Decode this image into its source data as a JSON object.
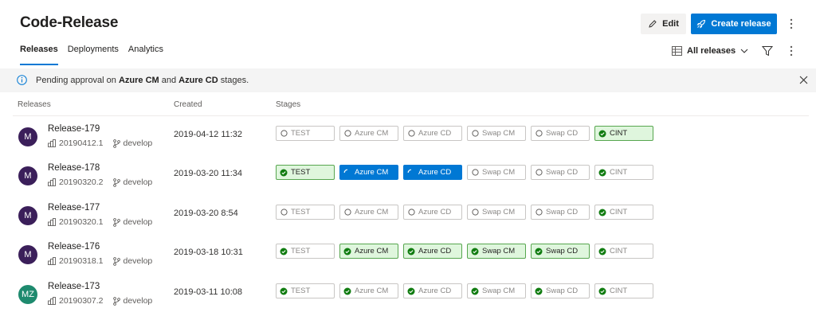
{
  "header": {
    "title": "Code-Release",
    "edit_label": "Edit",
    "create_label": "Create release"
  },
  "tabs": [
    {
      "label": "Releases",
      "active": true
    },
    {
      "label": "Deployments",
      "active": false
    },
    {
      "label": "Analytics",
      "active": false
    }
  ],
  "filter": {
    "label": "All releases"
  },
  "banner": {
    "prefix": "Pending approval on ",
    "stage1": "Azure CM",
    "middle": " and ",
    "stage2": "Azure CD",
    "suffix": " stages."
  },
  "columns": {
    "releases": "Releases",
    "created": "Created",
    "stages": "Stages"
  },
  "colors": {
    "accent": "#0078d4",
    "success_bg": "#dff6dd",
    "success_border": "#57a64f",
    "success_icon": "#107c10"
  },
  "releases": [
    {
      "avatar": "M",
      "avatar_color": "#3b1f5a",
      "name": "Release-179",
      "build": "20190412.1",
      "branch": "develop",
      "created": "2019-04-12 11:32",
      "stages": [
        {
          "name": "TEST",
          "status": "pending"
        },
        {
          "name": "Azure CM",
          "status": "pending"
        },
        {
          "name": "Azure CD",
          "status": "pending"
        },
        {
          "name": "Swap CM",
          "status": "pending"
        },
        {
          "name": "Swap CD",
          "status": "pending"
        },
        {
          "name": "CINT",
          "status": "success"
        }
      ]
    },
    {
      "avatar": "M",
      "avatar_color": "#3b1f5a",
      "name": "Release-178",
      "build": "20190320.2",
      "branch": "develop",
      "created": "2019-03-20 11:34",
      "stages": [
        {
          "name": "TEST",
          "status": "success"
        },
        {
          "name": "Azure CM",
          "status": "inprogress"
        },
        {
          "name": "Azure CD",
          "status": "inprogress"
        },
        {
          "name": "Swap CM",
          "status": "pending"
        },
        {
          "name": "Swap CD",
          "status": "pending"
        },
        {
          "name": "CINT",
          "status": "success-dim"
        }
      ]
    },
    {
      "avatar": "M",
      "avatar_color": "#3b1f5a",
      "name": "Release-177",
      "build": "20190320.1",
      "branch": "develop",
      "created": "2019-03-20 8:54",
      "stages": [
        {
          "name": "TEST",
          "status": "pending"
        },
        {
          "name": "Azure CM",
          "status": "pending"
        },
        {
          "name": "Azure CD",
          "status": "pending"
        },
        {
          "name": "Swap CM",
          "status": "pending"
        },
        {
          "name": "Swap CD",
          "status": "pending"
        },
        {
          "name": "CINT",
          "status": "success-dim"
        }
      ]
    },
    {
      "avatar": "M",
      "avatar_color": "#3b1f5a",
      "name": "Release-176",
      "build": "20190318.1",
      "branch": "develop",
      "created": "2019-03-18 10:31",
      "stages": [
        {
          "name": "TEST",
          "status": "success-dim"
        },
        {
          "name": "Azure CM",
          "status": "success"
        },
        {
          "name": "Azure CD",
          "status": "success"
        },
        {
          "name": "Swap CM",
          "status": "success"
        },
        {
          "name": "Swap CD",
          "status": "success"
        },
        {
          "name": "CINT",
          "status": "success-dim"
        }
      ]
    },
    {
      "avatar": "MZ",
      "avatar_color": "#1e8a6e",
      "name": "Release-173",
      "build": "20190307.2",
      "branch": "develop",
      "created": "2019-03-11 10:08",
      "stages": [
        {
          "name": "TEST",
          "status": "success-dim"
        },
        {
          "name": "Azure CM",
          "status": "success-dim"
        },
        {
          "name": "Azure CD",
          "status": "success-dim"
        },
        {
          "name": "Swap CM",
          "status": "success-dim"
        },
        {
          "name": "Swap CD",
          "status": "success-dim"
        },
        {
          "name": "CINT",
          "status": "success-dim"
        }
      ]
    }
  ]
}
